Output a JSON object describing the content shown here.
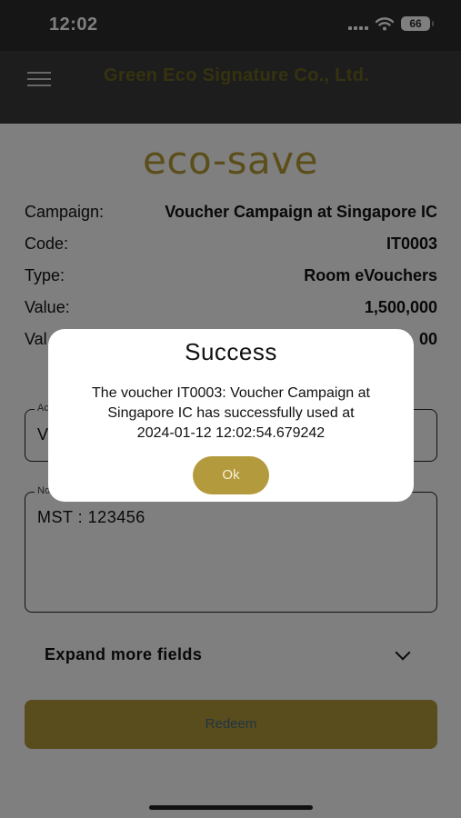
{
  "status_bar": {
    "time": "12:02",
    "battery": "66"
  },
  "header": {
    "company": "Green Eco Signature Co., Ltd."
  },
  "logo": "eco-save",
  "info": [
    {
      "label": "Campaign:",
      "value": "Voucher Campaign at Singapore IC"
    },
    {
      "label": "Code:",
      "value": "IT0003"
    },
    {
      "label": "Type:",
      "value": "Room eVouchers"
    },
    {
      "label": "Value:",
      "value": "1,500,000"
    },
    {
      "label": "Val",
      "value": "00"
    }
  ],
  "fields": {
    "first": {
      "label": "Ac",
      "value": "V"
    },
    "note": {
      "label": "No",
      "value": "MST : 123456"
    }
  },
  "expand_label": "Expand more fields",
  "redeem_label": "Redeem",
  "dialog": {
    "title": "Success",
    "message_lines": [
      "The voucher IT0003: Voucher Campaign at",
      "Singapore IC has successfully used at",
      "2024-01-12 12:02:54.679242"
    ],
    "ok_label": "Ok"
  },
  "colors": {
    "accent": "#b39a3c",
    "header_bg": "#3a3a3a",
    "logo": "#b79c35"
  }
}
